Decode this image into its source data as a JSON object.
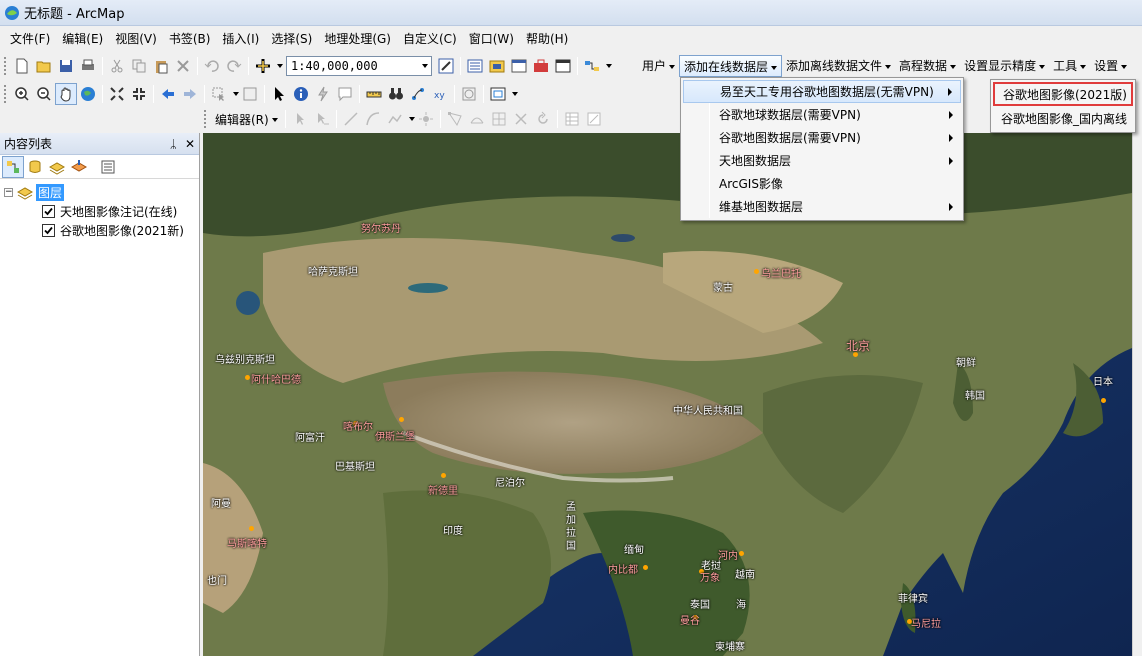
{
  "window": {
    "title": "无标题 - ArcMap"
  },
  "menubar": {
    "items": [
      "文件(F)",
      "编辑(E)",
      "视图(V)",
      "书签(B)",
      "插入(I)",
      "选择(S)",
      "地理处理(G)",
      "自定义(C)",
      "窗口(W)",
      "帮助(H)"
    ]
  },
  "toolbar": {
    "scale": "1:40,000,000"
  },
  "plugin_menu": {
    "items": [
      "用户",
      "添加在线数据层",
      "添加离线数据文件",
      "高程数据",
      "设置显示精度",
      "工具",
      "设置"
    ]
  },
  "editor": {
    "label": "编辑器(R)"
  },
  "toc": {
    "title": "内容列表",
    "root": "图层",
    "layers": [
      "天地图影像注记(在线)",
      "谷歌地图影像(2021新)"
    ],
    "pin": "ᛦ",
    "close": "✕"
  },
  "dropdown": {
    "items": [
      {
        "label": "易至天工专用谷歌地图数据层(无需VPN)",
        "submenu": true
      },
      {
        "label": "谷歌地球数据层(需要VPN)",
        "submenu": true
      },
      {
        "label": "谷歌地图数据层(需要VPN)",
        "submenu": true
      },
      {
        "label": "天地图数据层",
        "submenu": true
      },
      {
        "label": "ArcGIS影像",
        "submenu": false
      },
      {
        "label": "维基地图数据层",
        "submenu": true
      }
    ]
  },
  "submenu": {
    "items": [
      "谷歌地图影像(2021版)",
      "谷歌地图影像_国内离线"
    ]
  },
  "map": {
    "labels": {
      "astana": "努尔苏丹",
      "kazakhstan": "哈萨克斯坦",
      "mongolia": "蒙古",
      "ulaanbaatar": "乌兰巴托",
      "uzbekistan": "乌兹别克斯坦",
      "ashgabat": "阿什哈巴德",
      "afghanistan": "阿富汗",
      "kabul": "喀布尔",
      "islamabad": "伊斯兰堡",
      "pakistan": "巴基斯坦",
      "newdelhi": "新德里",
      "nepal": "尼泊尔",
      "china": "中华人民共和国",
      "beijing": "北京",
      "northkorea": "朝鲜",
      "southkorea": "韩国",
      "japan": "日本",
      "india": "印度",
      "oman": "阿曼",
      "muscat": "马斯喀特",
      "bangladesh": "孟加拉国",
      "myanmar": "缅甸",
      "naypyidaw": "内比都",
      "hanoi": "河内",
      "vientiane": "万象",
      "laos": "老挝",
      "vietnam": "越南",
      "thailand": "泰国",
      "bangkok": "曼谷",
      "cambodia": "柬埔寨",
      "philippines": "菲律宾",
      "manila": "马尼拉",
      "sea": "海",
      "yemen": "也门"
    }
  },
  "colors": {
    "selection": "#3399ff",
    "highlight_border": "#e03c3c",
    "ocean": "#1a3a6e"
  }
}
